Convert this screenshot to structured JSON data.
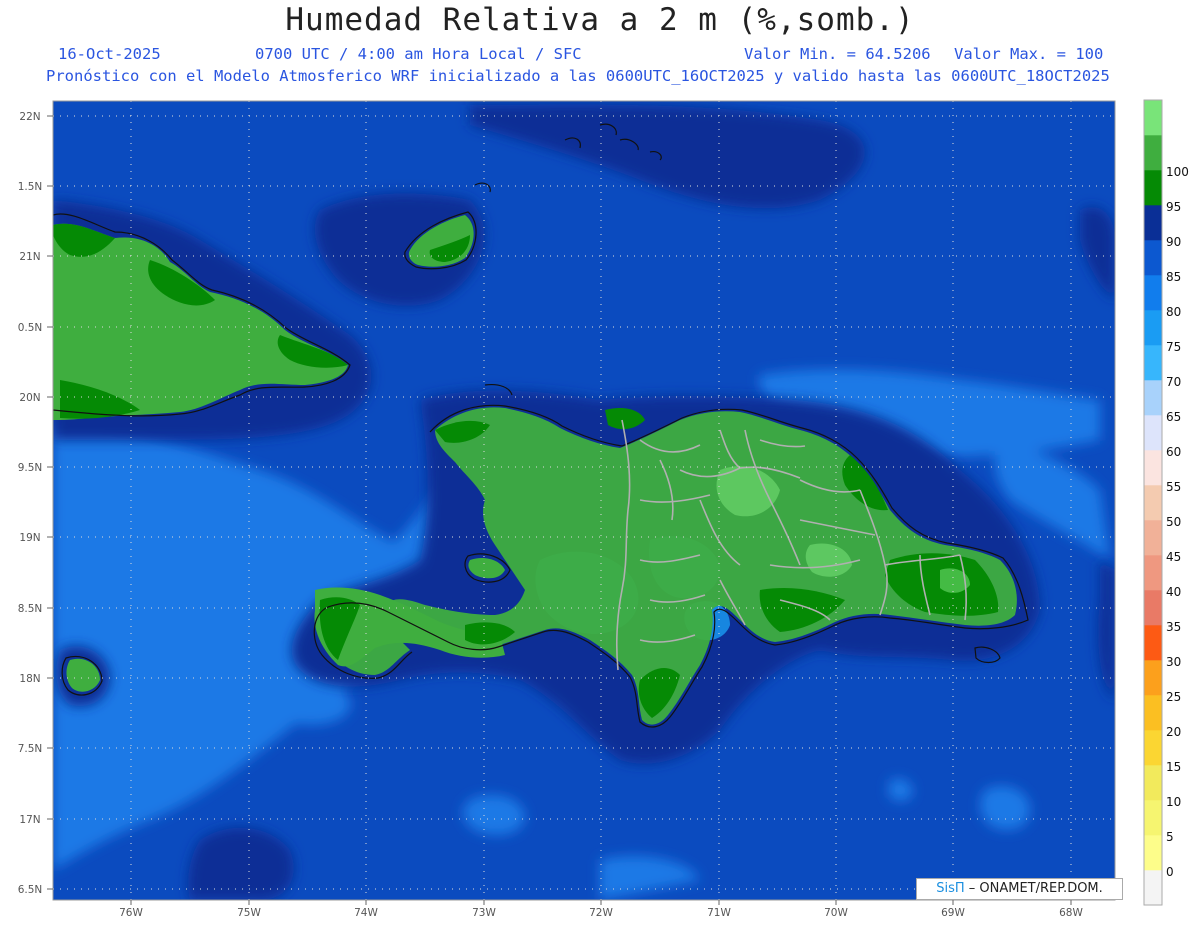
{
  "header": {
    "title": "Humedad Relativa a 2 m (%,somb.)",
    "date": "16-Oct-2025",
    "time": "0700 UTC / 4:00 am Hora Local / SFC",
    "min_label": "Valor Min. = 64.5206",
    "max_label": "Valor Max. = 100",
    "model_line": "Pronóstico con el Modelo Atmosferico WRF inicializado a las 0600UTC_16OCT2025 y valido hasta las  0600UTC_18OCT2025"
  },
  "map": {
    "lat_labels": [
      "22N",
      "1.5N",
      "21N",
      "0.5N",
      "20N",
      "9.5N",
      "19N",
      "8.5N",
      "18N",
      "7.5N",
      "17N",
      "6.5N"
    ],
    "lon_labels": [
      "76W",
      "75W",
      "74W",
      "73W",
      "72W",
      "71W",
      "70W",
      "69W",
      "68W"
    ],
    "land_color": "#3fae3f",
    "sea_color": "#0b4bbf",
    "dark_sea_color": "#0a2f96",
    "light_sea_color": "#1c79e6"
  },
  "colorbar": {
    "ticks": [
      "0",
      "5",
      "10",
      "15",
      "20",
      "25",
      "30",
      "35",
      "40",
      "45",
      "50",
      "55",
      "60",
      "65",
      "70",
      "75",
      "80",
      "85",
      "90",
      "95",
      "100"
    ],
    "colors": [
      "#f4f4f4",
      "#fdfd8a",
      "#f6f570",
      "#f2ea5c",
      "#fbd632",
      "#fbbf22",
      "#fca01c",
      "#fd5a14",
      "#e97a66",
      "#ef9880",
      "#f1b198",
      "#f4cbb0",
      "#fbe4e0",
      "#dde4fb",
      "#a8d2fb",
      "#37b6fc",
      "#1a9cf3",
      "#117ded",
      "#0c58d0",
      "#0a2f96",
      "#058a05",
      "#3fae3f",
      "#79e479"
    ]
  },
  "credit": {
    "brand": "SisΠ",
    "text": "– ONAMET/REP.DOM."
  }
}
